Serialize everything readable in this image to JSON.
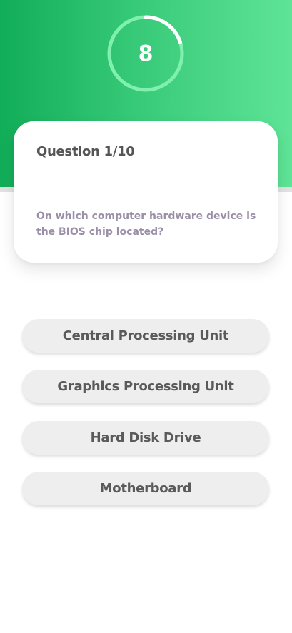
{
  "timer": {
    "value": "8",
    "progress": 0.8,
    "ring_track_color": "#7ff0ad",
    "ring_fill_color": "#ffffff"
  },
  "question": {
    "counter": "Question 1/10",
    "text": "On which computer hardware device is the BIOS chip located?"
  },
  "answers": [
    "Central Processing Unit",
    "Graphics Processing Unit",
    "Hard Disk Drive",
    "Motherboard"
  ],
  "colors": {
    "header_start": "#12ad58",
    "header_end": "#5fe497",
    "question_text": "#9b8fa8",
    "answer_bg": "#eeeeee"
  }
}
